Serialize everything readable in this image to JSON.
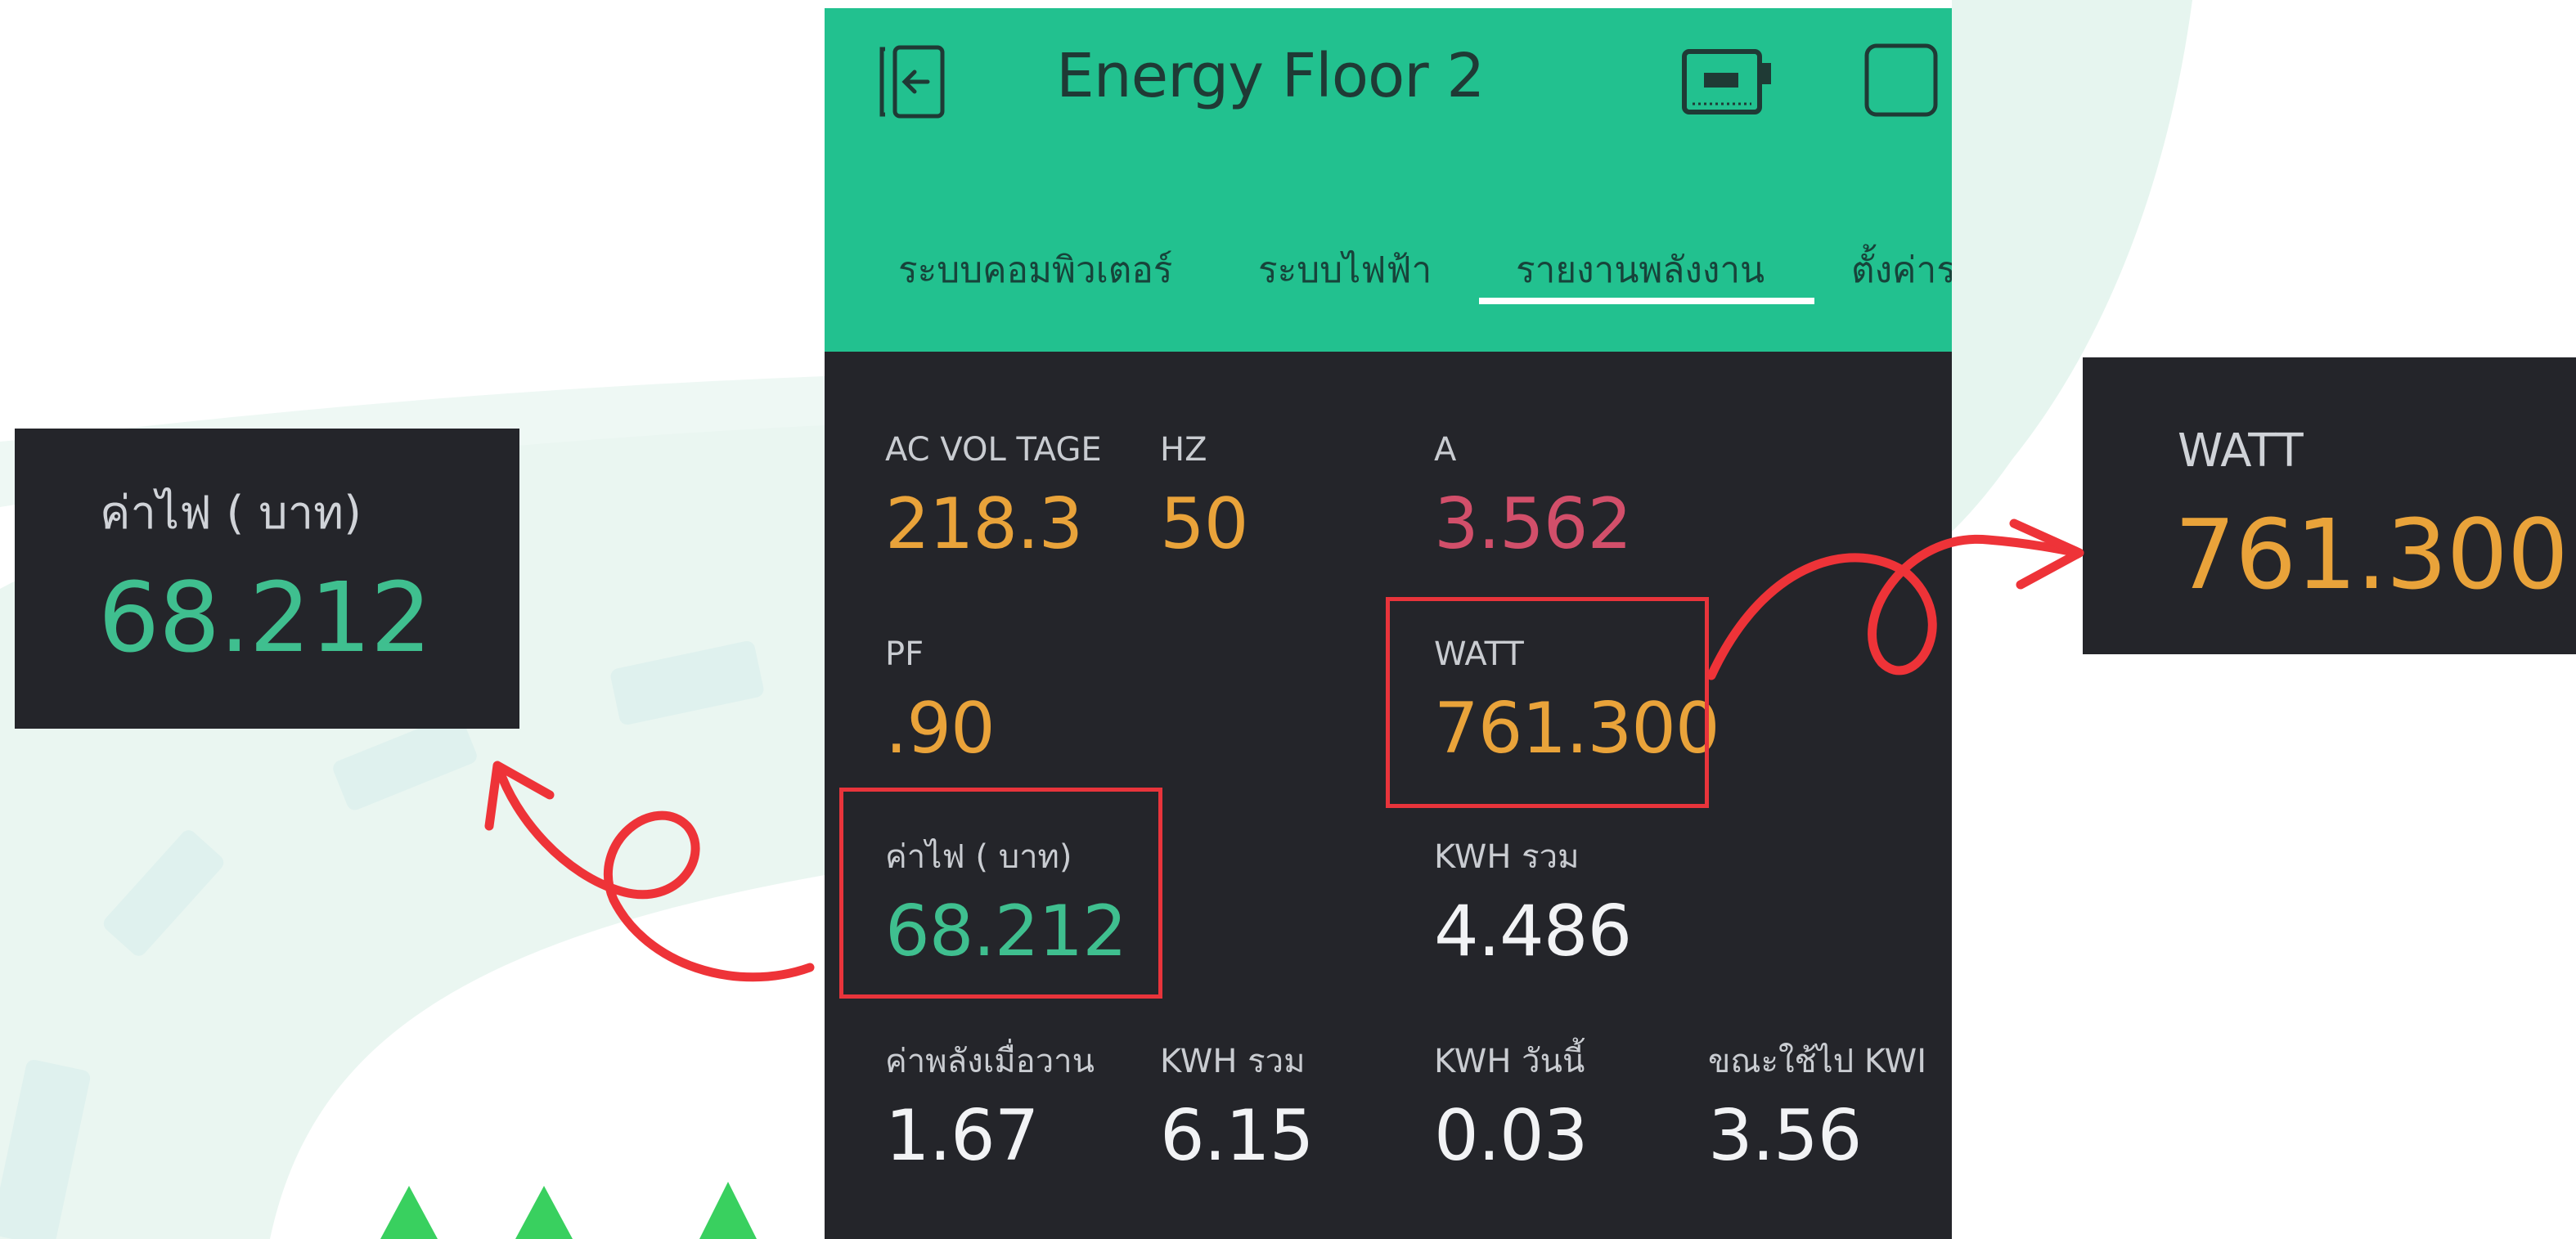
{
  "colors": {
    "accent_green": "#22c18f",
    "panel_dark": "#24252a",
    "value_orange": "#e9a33a",
    "value_pink": "#d24f6a",
    "value_teal": "#3fbf8f",
    "value_white": "#f2f3f5",
    "highlight_red": "#e8343b"
  },
  "app": {
    "title": "Energy Floor 2",
    "back_icon": "back-exit-icon",
    "device_icon": "device-board-icon",
    "square_icon": "square-icon"
  },
  "tabs": [
    {
      "label": "ระบบคอมพิวเตอร์"
    },
    {
      "label": "ระบบไฟฟ้า"
    },
    {
      "label": "รายงานพลังงาน",
      "active": true
    },
    {
      "label": "ตั้งค่าร"
    }
  ],
  "widgets": {
    "voltage": {
      "label": "AC VOL TAGE",
      "value": "218.3"
    },
    "hz": {
      "label": "HZ",
      "value": "50"
    },
    "amp": {
      "label": "A",
      "value": "3.562"
    },
    "pf": {
      "label": "PF",
      "value": ".90"
    },
    "watt": {
      "label": "WATT",
      "value": "761.300"
    },
    "cost": {
      "label": "ค่าไฟ ( บาท)",
      "value": "68.212"
    },
    "kwh_total": {
      "label": "KWH รวม",
      "value": "4.486"
    },
    "yesterday": {
      "label": "ค่าพลังเมื่อวาน",
      "value": "1.67"
    },
    "kwh_total2": {
      "label": "KWH รวม",
      "value": "6.15"
    },
    "kwh_today": {
      "label": "KWH วันนี้",
      "value": "0.03"
    },
    "using": {
      "label": "ขณะใช้ไป KWI",
      "value": "3.56"
    }
  },
  "callouts": {
    "cost": {
      "label": "ค่าไฟ ( บาท)",
      "value": "68.212"
    },
    "watt": {
      "label": "WATT",
      "value": "761.300"
    }
  }
}
